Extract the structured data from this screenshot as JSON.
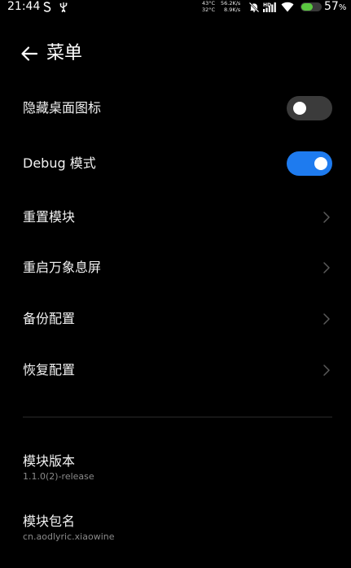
{
  "status_bar": {
    "time": "21:44",
    "temp_cpu": "43°C",
    "temp_battery": "32°C",
    "speed_up": "56.2K/s",
    "speed_down": "8.9K/s",
    "battery_level": "57",
    "battery_unit": "%",
    "icons": [
      "s-icon",
      "usb-icon",
      "mute-bell-icon",
      "hd-signal-icon",
      "wifi-icon",
      "battery-icon"
    ],
    "battery_color": "#5ac840"
  },
  "header": {
    "title": "菜单"
  },
  "menu": {
    "hide_icon": {
      "label": "隐藏桌面图标",
      "enabled": false
    },
    "debug_mode": {
      "label": "Debug 模式",
      "enabled": true
    },
    "reset_module": {
      "label": "重置模块"
    },
    "restart_screen": {
      "label": "重启万象息屏"
    },
    "backup_config": {
      "label": "备份配置"
    },
    "restore_config": {
      "label": "恢复配置"
    }
  },
  "info": {
    "version": {
      "title": "模块版本",
      "value": "1.1.0(2)-release"
    },
    "package": {
      "title": "模块包名",
      "value": "cn.aodlyric.xiaowine"
    }
  },
  "colors": {
    "background": "#000000",
    "toggle_on": "#1e7bef",
    "toggle_off": "#3b3b3b",
    "secondary_text": "#8a8a8a"
  }
}
